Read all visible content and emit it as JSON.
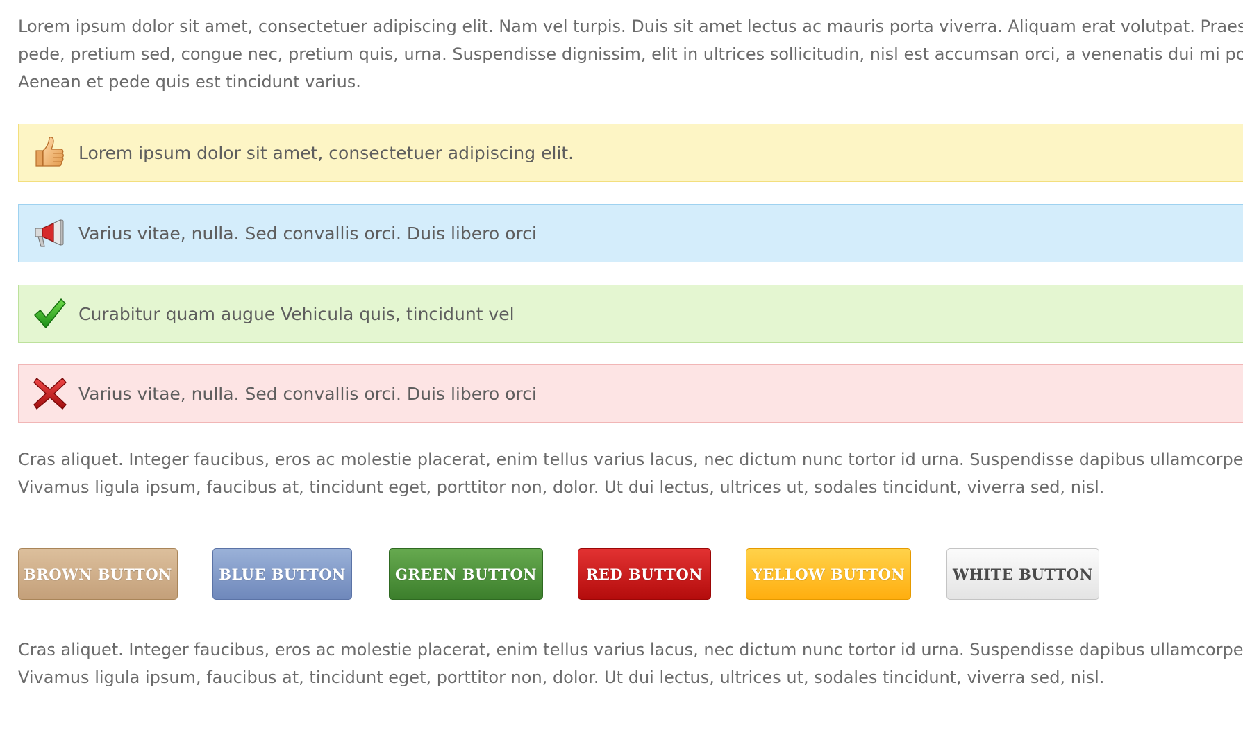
{
  "intro": {
    "lines": [
      "Lorem ipsum dolor sit amet, consectetuer adipiscing elit. Nam vel turpis. Duis sit amet lectus ac mauris porta viverra. Aliquam erat volutpat. Praesent",
      "pede, pretium sed, congue nec, pretium quis, urna. Suspendisse dignissim, elit in ultrices sollicitudin, nisl est accumsan orci, a venenatis dui mi porta p",
      "Aenean et pede quis est tincidunt varius."
    ]
  },
  "notices": [
    {
      "icon": "thumbs-up-icon",
      "text": "Lorem ipsum dolor sit amet, consectetuer adipiscing elit.",
      "color": "#fdf5c5"
    },
    {
      "icon": "megaphone-icon",
      "text": "Varius vitae, nulla. Sed convallis orci. Duis libero orci",
      "color": "#d4edfb"
    },
    {
      "icon": "checkmark-icon",
      "text": "Curabitur quam augue Vehicula quis, tincidunt vel",
      "color": "#e4f6d1"
    },
    {
      "icon": "cross-icon",
      "text": "Varius vitae, nulla. Sed convallis orci. Duis libero orci",
      "color": "#fde4e4"
    }
  ],
  "para2": {
    "lines": [
      "Cras aliquet. Integer faucibus, eros ac molestie placerat, enim tellus varius lacus, nec dictum nunc tortor id urna. Suspendisse dapibus ullamcorper pe",
      "Vivamus ligula ipsum, faucibus at, tincidunt eget, porttitor non, dolor. Ut dui lectus, ultrices ut, sodales tincidunt, viverra sed, nisl."
    ]
  },
  "buttons": [
    {
      "label": "BROWN BUTTON",
      "color": "#c4a07a"
    },
    {
      "label": "BLUE BUTTON",
      "color": "#7d95c6"
    },
    {
      "label": "GREEN BUTTON",
      "color": "#4a8e37"
    },
    {
      "label": "RED BUTTON",
      "color": "#cc1a1a"
    },
    {
      "label": "YELLOW BUTTON",
      "color": "#ffbc22"
    },
    {
      "label": "WHITE BUTTON",
      "color": "#f0f0f0"
    }
  ],
  "para3": {
    "lines": [
      "Cras aliquet. Integer faucibus, eros ac molestie placerat, enim tellus varius lacus, nec dictum nunc tortor id urna. Suspendisse dapibus ullamcorper pe",
      "Vivamus ligula ipsum, faucibus at, tincidunt eget, porttitor non, dolor. Ut dui lectus, ultrices ut, sodales tincidunt, viverra sed, nisl."
    ]
  }
}
